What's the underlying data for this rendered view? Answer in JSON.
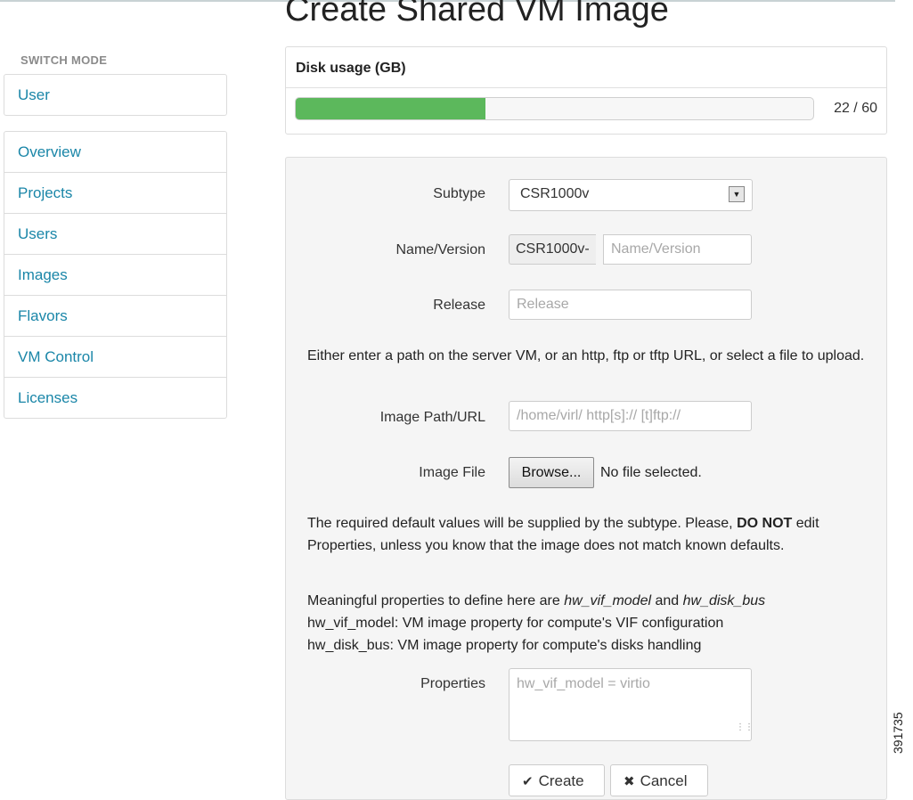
{
  "page": {
    "title": "Create Shared VM Image"
  },
  "sidebar": {
    "switch_mode_label": "SWITCH MODE",
    "mode_item": "User",
    "items": [
      {
        "label": "Overview"
      },
      {
        "label": "Projects"
      },
      {
        "label": "Users"
      },
      {
        "label": "Images"
      },
      {
        "label": "Flavors"
      },
      {
        "label": "VM Control"
      },
      {
        "label": "Licenses"
      }
    ]
  },
  "disk_usage": {
    "title": "Disk usage (GB)",
    "used": 22,
    "total": 60,
    "display": "22 / 60",
    "fill_color": "#5cb85c"
  },
  "form": {
    "subtype": {
      "label": "Subtype",
      "value": "CSR1000v"
    },
    "name_version": {
      "label": "Name/Version",
      "prefix": "CSR1000v-",
      "placeholder": "Name/Version"
    },
    "release": {
      "label": "Release",
      "placeholder": "Release"
    },
    "path_help": "Either enter a path on the server VM, or an http, ftp or tftp URL, or select a file to upload.",
    "image_path": {
      "label": "Image Path/URL",
      "placeholder": "/home/virl/ http[s]:// [t]ftp://"
    },
    "image_file": {
      "label": "Image File",
      "browse_label": "Browse...",
      "status": "No file selected."
    },
    "defaults_help_pre": "The required default values will be supplied by the subtype. Please,",
    "defaults_help_bold": "DO NOT",
    "defaults_help_post": "edit Properties, unless you know that the image does not match known defaults.",
    "props_help_pre": "Meaningful properties to define here are",
    "props_help_em1": "hw_vif_model",
    "props_help_and": "and",
    "props_help_em2": "hw_disk_bus",
    "props_help_line2": "hw_vif_model: VM image property for compute's VIF configuration",
    "props_help_line3": "hw_disk_bus: VM image property for compute's disks handling",
    "properties": {
      "label": "Properties",
      "placeholder": "hw_vif_model = virtio"
    },
    "create_label": "Create",
    "cancel_label": "Cancel"
  },
  "figure_id": "391735"
}
